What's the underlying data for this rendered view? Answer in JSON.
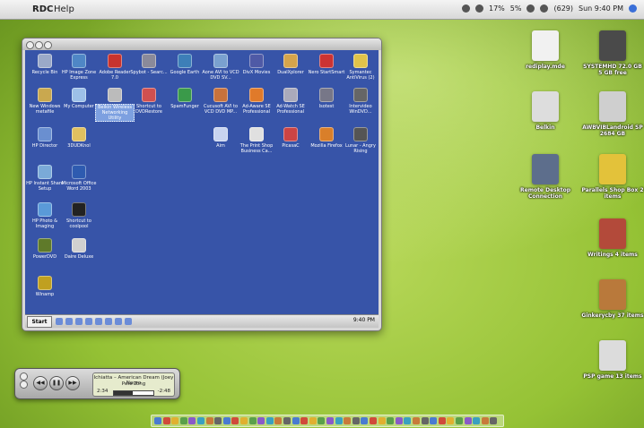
{
  "menubar": {
    "apple_glyph": "",
    "app_name": "RDC",
    "menu_help": "Help",
    "status": {
      "cpu": "17%",
      "pct": "5%",
      "battery": "(629)",
      "clock": "Sun 9:40 PM"
    }
  },
  "xp_desktop": {
    "icons": [
      {
        "label": "Recycle Bin",
        "color": "#9aa9c8"
      },
      {
        "label": "HP Image Zone Express",
        "color": "#4f87c6"
      },
      {
        "label": "Adobe Reader 7.0",
        "color": "#c8332e"
      },
      {
        "label": "Spybot - Searc...",
        "color": "#8a8a9a"
      },
      {
        "label": "Google Earth",
        "color": "#3d7fb8"
      },
      {
        "label": "Aone AVI to VCD DVD SV...",
        "color": "#7aa1cf"
      },
      {
        "label": "DivX Movies",
        "color": "#4f5aa6"
      },
      {
        "label": "DualXplorer",
        "color": "#d5a44c"
      },
      {
        "label": "Nero StartSmart",
        "color": "#c33"
      },
      {
        "label": "Symantec AntiVirus (2)",
        "color": "#e0c34a"
      },
      {
        "label": "New Windows metafile",
        "color": "#c9a84f"
      },
      {
        "label": "My Computer",
        "color": "#9dc0e8"
      },
      {
        "label": "Belkin Wireless Networking Utility",
        "color": "#bbb"
      },
      {
        "label": "Shortcut to DVDRestore",
        "color": "#d05050"
      },
      {
        "label": "SpamFunger",
        "color": "#3a9a4a"
      },
      {
        "label": "Cucusoft AVI to VCD DVD MP...",
        "color": "#c8723c"
      },
      {
        "label": "Ad-Aware SE Professional",
        "color": "#e07a2a"
      },
      {
        "label": "Ad-Watch SE Professional",
        "color": "#aab"
      },
      {
        "label": "Isotest",
        "color": "#778"
      },
      {
        "label": "Intervideo WinDVD...",
        "color": "#666"
      },
      {
        "label": "HP Director",
        "color": "#6a8fd0"
      },
      {
        "label": "3DUDKnol",
        "color": "#e0c060"
      },
      {
        "label": "Aim",
        "color": "#c8d4f0"
      },
      {
        "label": "The Print Shop Business Ca...",
        "color": "#e0e0e0"
      },
      {
        "label": "PicasaC",
        "color": "#c44"
      },
      {
        "label": "Mozilla Firefox",
        "color": "#d97f2a"
      },
      {
        "label": "Lunar - Angry Rising",
        "color": "#555"
      },
      {
        "label": "HP Instant Share Setup",
        "color": "#7aaad8"
      },
      {
        "label": "Microsoft Office Word 2003",
        "color": "#2e5bb0"
      },
      {
        "label": "HP Photo & Imaging",
        "color": "#5a9ad8"
      },
      {
        "label": "Shortcut to coolpool",
        "color": "#222"
      },
      {
        "label": "PowerDVD",
        "color": "#5f7a2a"
      },
      {
        "label": "Daire Deluxe",
        "color": "#d0d0d0"
      },
      {
        "label": "Winamp",
        "color": "#c0a020"
      }
    ],
    "taskbar": {
      "start": "Start",
      "clock": "9:40 PM"
    }
  },
  "mac_desktop": {
    "icons": [
      {
        "label": "rediplay.mde",
        "color": "#f1f1f1"
      },
      {
        "label": "SYSTEMHD 72.0 GB 5 GB free",
        "color": "#4a4a4a"
      },
      {
        "label": "Belkin",
        "color": "#ddd"
      },
      {
        "label": "AWBVIBLandroid SP 2684 GB",
        "color": "#cfcfcf"
      },
      {
        "label": "Remote Desktop Connection",
        "color": "#5d6e8c"
      },
      {
        "label": "Parallels Shop Box 2 items",
        "color": "#e3c23a"
      },
      {
        "label": "Writings 4 items",
        "color": "#b34a3a"
      },
      {
        "label": "Ginkerycby 37 items",
        "color": "#b9793b"
      },
      {
        "label": "PSP game 13 items",
        "color": "#dcdcdc"
      }
    ]
  },
  "itunes": {
    "track": "Ichiatta – American Dream (Joey Negro",
    "artist": "Pete Tong",
    "elapsed": "2:34",
    "remaining": "-2:48",
    "progress": 0.48
  }
}
